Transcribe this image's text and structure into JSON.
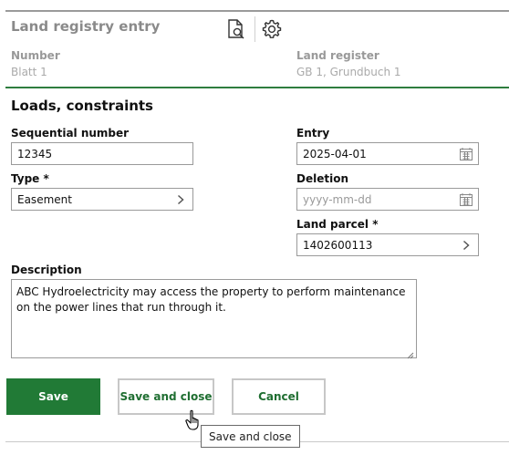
{
  "header": {
    "title": "Land registry entry",
    "number_label": "Number",
    "number_value": "Blatt 1",
    "register_label": "Land register",
    "register_value": "GB 1, Grundbuch 1"
  },
  "section": {
    "title": "Loads, constraints"
  },
  "fields": {
    "sequential_number": {
      "label": "Sequential number",
      "value": "12345"
    },
    "type": {
      "label": "Type *",
      "value": "Easement"
    },
    "entry": {
      "label": "Entry",
      "value": "2025-04-01"
    },
    "deletion": {
      "label": "Deletion",
      "placeholder": "yyyy-mm-dd"
    },
    "land_parcel": {
      "label": "Land parcel *",
      "value": "1402600113"
    },
    "description": {
      "label": "Description",
      "value": "ABC Hydroelectricity may access the property to perform maintenance on the power lines that run through it."
    }
  },
  "buttons": {
    "save": "Save",
    "save_and_close": "Save and close",
    "cancel": "Cancel"
  },
  "tooltip": "Save and close",
  "icons": {
    "preview": "document-search-icon",
    "settings": "gear-icon",
    "chevron": "chevron-right-icon",
    "calendar": "calendar-icon",
    "cursor": "hand-pointer-icon"
  },
  "colors": {
    "accent": "#217a36",
    "accent_text": "#1f6e31",
    "header_text": "#8a8a8a",
    "border": "#9a9a9a"
  }
}
